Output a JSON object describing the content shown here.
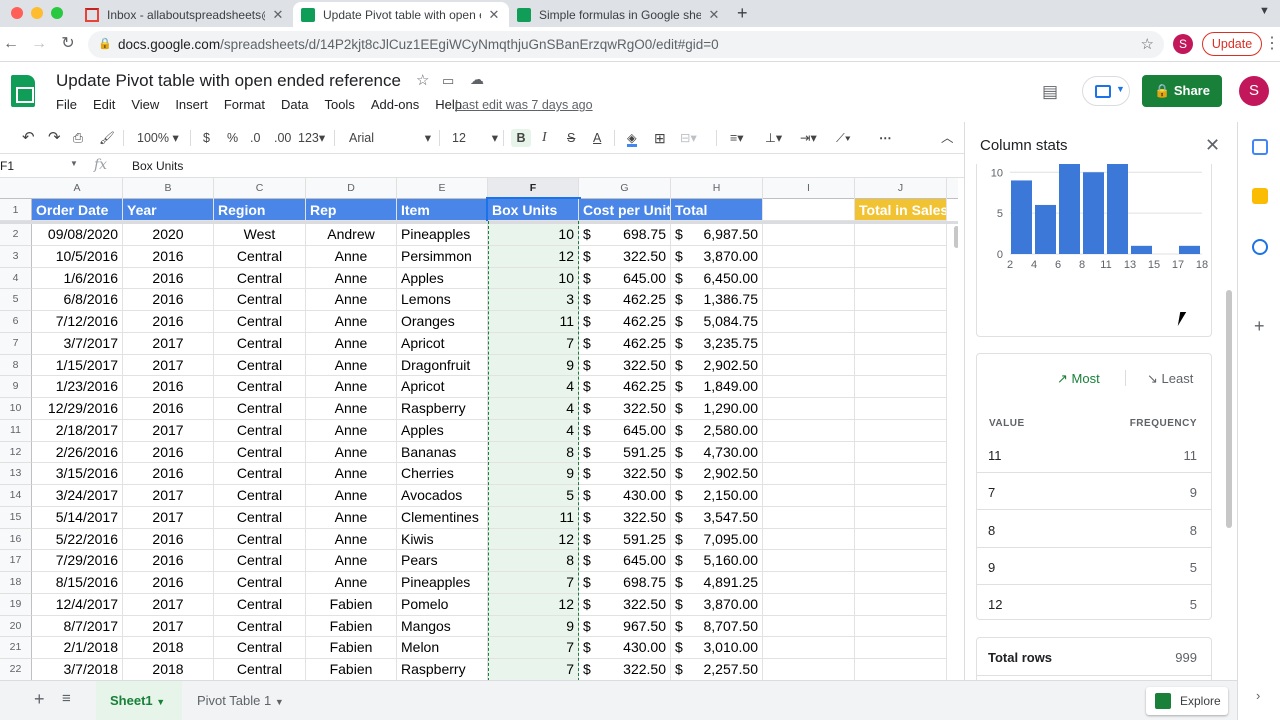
{
  "browser": {
    "tabs": [
      {
        "label": "Inbox - allaboutspreadsheets@",
        "icon": "gmail-icon",
        "active": false
      },
      {
        "label": "Update Pivot table with open e",
        "icon": "sheets-icon",
        "active": true
      },
      {
        "label": "Simple formulas in Google she",
        "icon": "sheets-icon",
        "active": false
      }
    ],
    "new_tab": "+",
    "url_domain": "docs.google.com",
    "url_path": "/spreadsheets/d/14P2kjt8cJlCuz1EEgiWCyNmqthjuGnSBanErzqwRgO0/edit#gid=0",
    "profile_initial": "S",
    "update_label": "Update"
  },
  "doc": {
    "title": "Update Pivot table with open ended reference",
    "menu": [
      "File",
      "Edit",
      "View",
      "Insert",
      "Format",
      "Data",
      "Tools",
      "Add-ons",
      "Help"
    ],
    "last_edit": "Last edit was 7 days ago",
    "share_label": "Share",
    "avatar_initial": "S"
  },
  "toolbar": {
    "zoom": "100%",
    "currency": "$",
    "percent": "%",
    "dec_decrease": ".0",
    "dec_increase": ".00",
    "format_more": "123",
    "font": "Arial",
    "font_size": "12",
    "bold": "B",
    "italic": "I",
    "strike": "S",
    "text_color": "A"
  },
  "formula_bar": {
    "cell_ref": "F1",
    "fx": "fx",
    "value": "Box Units"
  },
  "grid": {
    "columns": [
      "A",
      "B",
      "C",
      "D",
      "E",
      "F",
      "G",
      "H",
      "I",
      "J"
    ],
    "header_row": [
      "Order Date",
      "Year",
      "Region",
      "Rep",
      "Item",
      "Box Units",
      "Cost per Unit",
      "Total",
      "",
      "Total in Sales"
    ],
    "rows": [
      {
        "n": "2",
        "date": "09/08/2020",
        "year": "2020",
        "region": "West",
        "rep": "Andrew",
        "item": "Pineapples",
        "units": "10",
        "cost": "698.75",
        "total": "6,987.50"
      },
      {
        "n": "3",
        "date": "10/5/2016",
        "year": "2016",
        "region": "Central",
        "rep": "Anne",
        "item": "Persimmon",
        "units": "12",
        "cost": "322.50",
        "total": "3,870.00"
      },
      {
        "n": "4",
        "date": "1/6/2016",
        "year": "2016",
        "region": "Central",
        "rep": "Anne",
        "item": "Apples",
        "units": "10",
        "cost": "645.00",
        "total": "6,450.00"
      },
      {
        "n": "5",
        "date": "6/8/2016",
        "year": "2016",
        "region": "Central",
        "rep": "Anne",
        "item": "Lemons",
        "units": "3",
        "cost": "462.25",
        "total": "1,386.75"
      },
      {
        "n": "6",
        "date": "7/12/2016",
        "year": "2016",
        "region": "Central",
        "rep": "Anne",
        "item": "Oranges",
        "units": "11",
        "cost": "462.25",
        "total": "5,084.75"
      },
      {
        "n": "7",
        "date": "3/7/2017",
        "year": "2017",
        "region": "Central",
        "rep": "Anne",
        "item": "Apricot",
        "units": "7",
        "cost": "462.25",
        "total": "3,235.75"
      },
      {
        "n": "8",
        "date": "1/15/2017",
        "year": "2017",
        "region": "Central",
        "rep": "Anne",
        "item": "Dragonfruit",
        "units": "9",
        "cost": "322.50",
        "total": "2,902.50"
      },
      {
        "n": "9",
        "date": "1/23/2016",
        "year": "2016",
        "region": "Central",
        "rep": "Anne",
        "item": "Apricot",
        "units": "4",
        "cost": "462.25",
        "total": "1,849.00"
      },
      {
        "n": "10",
        "date": "12/29/2016",
        "year": "2016",
        "region": "Central",
        "rep": "Anne",
        "item": "Raspberry",
        "units": "4",
        "cost": "322.50",
        "total": "1,290.00"
      },
      {
        "n": "11",
        "date": "2/18/2017",
        "year": "2017",
        "region": "Central",
        "rep": "Anne",
        "item": "Apples",
        "units": "4",
        "cost": "645.00",
        "total": "2,580.00"
      },
      {
        "n": "12",
        "date": "2/26/2016",
        "year": "2016",
        "region": "Central",
        "rep": "Anne",
        "item": "Bananas",
        "units": "8",
        "cost": "591.25",
        "total": "4,730.00"
      },
      {
        "n": "13",
        "date": "3/15/2016",
        "year": "2016",
        "region": "Central",
        "rep": "Anne",
        "item": "Cherries",
        "units": "9",
        "cost": "322.50",
        "total": "2,902.50"
      },
      {
        "n": "14",
        "date": "3/24/2017",
        "year": "2017",
        "region": "Central",
        "rep": "Anne",
        "item": "Avocados",
        "units": "5",
        "cost": "430.00",
        "total": "2,150.00"
      },
      {
        "n": "15",
        "date": "5/14/2017",
        "year": "2017",
        "region": "Central",
        "rep": "Anne",
        "item": "Clementines",
        "units": "11",
        "cost": "322.50",
        "total": "3,547.50"
      },
      {
        "n": "16",
        "date": "5/22/2016",
        "year": "2016",
        "region": "Central",
        "rep": "Anne",
        "item": "Kiwis",
        "units": "12",
        "cost": "591.25",
        "total": "7,095.00"
      },
      {
        "n": "17",
        "date": "7/29/2016",
        "year": "2016",
        "region": "Central",
        "rep": "Anne",
        "item": "Pears",
        "units": "8",
        "cost": "645.00",
        "total": "5,160.00"
      },
      {
        "n": "18",
        "date": "8/15/2016",
        "year": "2016",
        "region": "Central",
        "rep": "Anne",
        "item": "Pineapples",
        "units": "7",
        "cost": "698.75",
        "total": "4,891.25"
      },
      {
        "n": "19",
        "date": "12/4/2017",
        "year": "2017",
        "region": "Central",
        "rep": "Fabien",
        "item": "Pomelo",
        "units": "12",
        "cost": "322.50",
        "total": "3,870.00"
      },
      {
        "n": "20",
        "date": "8/7/2017",
        "year": "2017",
        "region": "Central",
        "rep": "Fabien",
        "item": "Mangos",
        "units": "9",
        "cost": "967.50",
        "total": "8,707.50"
      },
      {
        "n": "21",
        "date": "2/1/2018",
        "year": "2018",
        "region": "Central",
        "rep": "Fabien",
        "item": "Melon",
        "units": "7",
        "cost": "430.00",
        "total": "3,010.00"
      },
      {
        "n": "22",
        "date": "3/7/2018",
        "year": "2018",
        "region": "Central",
        "rep": "Fabien",
        "item": "Raspberry",
        "units": "7",
        "cost": "322.50",
        "total": "2,257.50"
      }
    ],
    "currency_symbol": "$",
    "first_row_number": "1"
  },
  "sheets": {
    "add": "+",
    "tabs": [
      "Sheet1",
      "Pivot Table 1"
    ],
    "explore_label": "Explore"
  },
  "panel": {
    "title": "Column stats",
    "chart_data": {
      "type": "bar",
      "x": [
        2,
        3,
        4,
        5,
        6,
        7,
        8,
        9,
        10,
        11,
        12,
        13,
        14,
        15,
        16,
        17,
        18
      ],
      "x_tick_labels": [
        "2",
        "4",
        "6",
        "8",
        "11",
        "13",
        "15",
        "17",
        "18"
      ],
      "ytick_labels": [
        "0",
        "5",
        "10"
      ],
      "ylim": [
        0,
        12
      ]
    },
    "most_label": "Most",
    "least_label": "Least",
    "value_header": "VALUE",
    "frequency_header": "FREQUENCY",
    "frequencies": [
      {
        "value": "11",
        "freq": "11"
      },
      {
        "value": "7",
        "freq": "9"
      },
      {
        "value": "8",
        "freq": "8"
      },
      {
        "value": "9",
        "freq": "5"
      },
      {
        "value": "12",
        "freq": "5"
      }
    ],
    "total_rows_label": "Total rows",
    "total_rows_value": "999"
  },
  "colors": {
    "header_blue": "#4a86e8",
    "header_yellow": "#f1c232",
    "sheets_green": "#188038",
    "bar_blue": "#3c78d8"
  }
}
